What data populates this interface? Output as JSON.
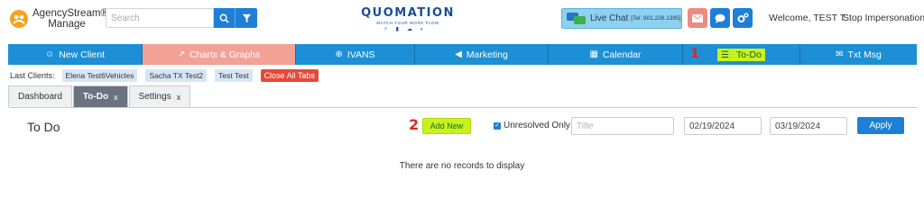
{
  "header": {
    "brand_line1": "AgencyStream®",
    "brand_line2": "Manage",
    "search_placeholder": "Search",
    "logo_title": "QUOMATION",
    "logo_tagline": "MATCH YOUR WORK FLOW",
    "live_chat_label": "Live Chat",
    "live_chat_tel": "[Tel: 801.226.1395]",
    "welcome": "Welcome, TEST T.",
    "stop_impersonation": "Stop Impersonation",
    "icons": [
      "search-icon",
      "filter-icon",
      "envelope-icon",
      "comment-icon",
      "cogs-icon"
    ]
  },
  "nav": {
    "items": [
      {
        "label": "New Client",
        "icon": "user-icon",
        "glyph": "☺"
      },
      {
        "label": "Charts & Graphs",
        "icon": "chart-icon",
        "glyph": "↗"
      },
      {
        "label": "IVANS",
        "icon": "circle-plus-icon",
        "glyph": "⊕"
      },
      {
        "label": "Marketing",
        "icon": "megaphone-icon",
        "glyph": "◀"
      },
      {
        "label": "Calendar",
        "icon": "calendar-icon",
        "glyph": "▦"
      },
      {
        "label": "To-Do",
        "icon": "list-icon",
        "glyph": "☰"
      },
      {
        "label": "Txt Msg",
        "icon": "comments-icon",
        "glyph": "✉"
      }
    ],
    "active": "Charts & Graphs",
    "annotation": "1"
  },
  "last_clients": {
    "label": "Last Clients:",
    "clients": [
      "Elena Test6Vehicles",
      "Sacha TX Test2",
      "Test Test"
    ],
    "close_all": "Close All Tabs"
  },
  "tabs": [
    {
      "label": "Dashboard",
      "closable": false,
      "active": false
    },
    {
      "label": "To-Do",
      "closable": true,
      "active": true
    },
    {
      "label": "Settings",
      "closable": true,
      "active": false
    }
  ],
  "tab_close_glyph": "x",
  "todo": {
    "title": "To Do",
    "annotation": "2",
    "add_new": "Add New",
    "unresolved_label": "Unresolved Only",
    "unresolved_checked": true,
    "title_placeholder": "Title",
    "date_from": "02/19/2024",
    "date_to": "03/19/2024",
    "apply": "Apply",
    "empty_message": "There are no records to display"
  },
  "colors": {
    "primary": "#1c8fd6",
    "active_tab": "#f2a197",
    "highlight": "#c8f21b",
    "annotation": "#e02525",
    "close_all": "#e7483c"
  }
}
